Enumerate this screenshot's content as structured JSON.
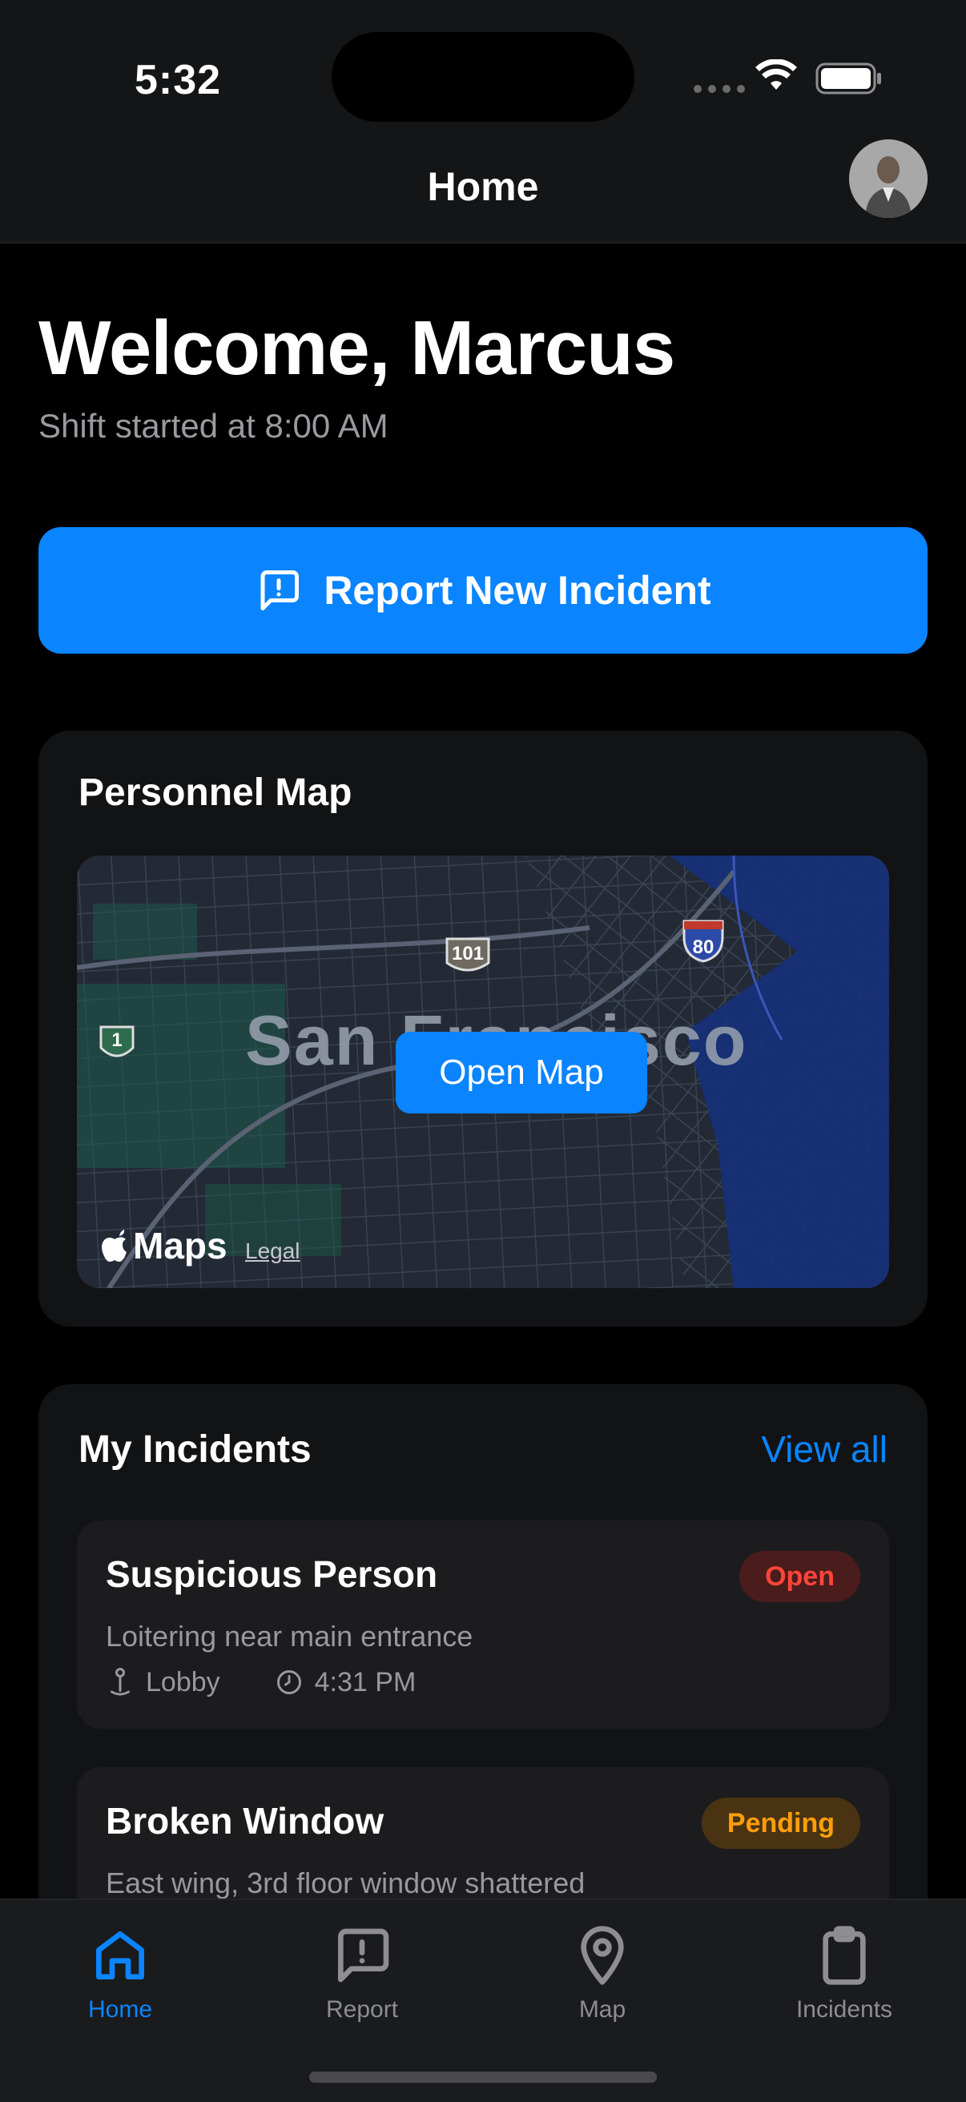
{
  "status": {
    "time": "5:32"
  },
  "nav": {
    "title": "Home"
  },
  "welcome": {
    "title": "Welcome, Marcus",
    "subtitle": "Shift started at 8:00 AM"
  },
  "report_button": {
    "label": "Report New Incident",
    "icon": "message-alert-icon"
  },
  "map_card": {
    "title": "Personnel Map",
    "city_label": "San Francisco",
    "open_label": "Open Map",
    "maps_brand": "Maps",
    "legal": "Legal",
    "shields": [
      "101",
      "80",
      "1"
    ]
  },
  "incidents": {
    "title": "My Incidents",
    "view_all": "View all",
    "items": [
      {
        "title": "Suspicious Person",
        "description": "Loitering near main entrance",
        "location": "Lobby",
        "time": "4:31 PM",
        "status": "Open",
        "status_color": "#ff453a"
      },
      {
        "title": "Broken Window",
        "description": "East wing, 3rd floor window shattered",
        "status": "Pending",
        "status_color": "#ff9f0a"
      }
    ]
  },
  "tabs": [
    {
      "label": "Home",
      "icon": "home-icon",
      "active": true
    },
    {
      "label": "Report",
      "icon": "message-alert-icon",
      "active": false
    },
    {
      "label": "Map",
      "icon": "map-pin-icon",
      "active": false
    },
    {
      "label": "Incidents",
      "icon": "clipboard-icon",
      "active": false
    }
  ],
  "colors": {
    "accent": "#0a84ff",
    "background": "#000000",
    "card": "#111315"
  }
}
